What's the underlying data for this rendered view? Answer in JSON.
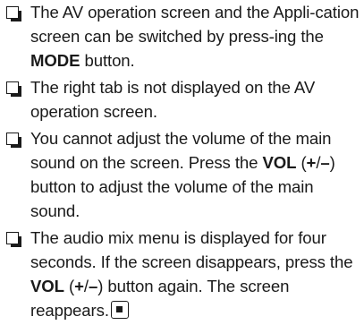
{
  "notes": [
    {
      "parts": [
        {
          "text": "The AV operation screen and the Appli-cation screen can be switched by press-ing the ",
          "bold": false
        },
        {
          "text": "MODE",
          "bold": true
        },
        {
          "text": " button.",
          "bold": false
        }
      ]
    },
    {
      "parts": [
        {
          "text": "The right tab is not displayed on the AV operation screen.",
          "bold": false
        }
      ]
    },
    {
      "parts": [
        {
          "text": "You cannot adjust the volume of the main sound on the screen. Press the ",
          "bold": false
        },
        {
          "text": "VOL",
          "bold": true
        },
        {
          "text": " (",
          "bold": false
        },
        {
          "text": "+",
          "bold": true
        },
        {
          "text": "/",
          "bold": false
        },
        {
          "text": "–",
          "bold": true
        },
        {
          "text": ") button to adjust the volume of the main sound.",
          "bold": false
        }
      ]
    },
    {
      "parts": [
        {
          "text": "The audio mix menu is displayed for four seconds. If the screen disappears, press the ",
          "bold": false
        },
        {
          "text": "VOL",
          "bold": true
        },
        {
          "text": " (",
          "bold": false
        },
        {
          "text": "+",
          "bold": true
        },
        {
          "text": "/",
          "bold": false
        },
        {
          "text": "–",
          "bold": true
        },
        {
          "text": ") button again. The screen reappears.",
          "bold": false
        }
      ],
      "end_mark": true
    }
  ]
}
